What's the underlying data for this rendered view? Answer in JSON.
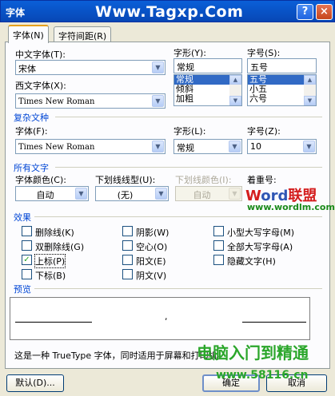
{
  "window": {
    "title": "字体",
    "watermark": "Www.Tagxp.Com",
    "help_glyph": "?",
    "close_glyph": "×"
  },
  "tabs": [
    {
      "label": "字体(N)",
      "active": true
    },
    {
      "label": "字符间距(R)",
      "active": false
    }
  ],
  "font_tab": {
    "chinese_font": {
      "label": "中文字体(T):",
      "value": "宋体"
    },
    "western_font": {
      "label": "西文字体(X):",
      "value": "Times New Roman"
    },
    "style": {
      "label": "字形(Y):",
      "value": "常规",
      "items": [
        "常规",
        "倾斜",
        "加粗"
      ],
      "selected": 0
    },
    "size": {
      "label": "字号(S):",
      "value": "五号",
      "items": [
        "五号",
        "小五",
        "六号"
      ],
      "selected": 0
    },
    "complex": {
      "section": "复杂文种",
      "font_label": "字体(F):",
      "font_value": "Times New Roman",
      "style_label": "字形(L):",
      "style_value": "常规",
      "size_label": "字号(Z):",
      "size_value": "10"
    },
    "all_text": {
      "section": "所有文字",
      "color_label": "字体颜色(C):",
      "color_value": "自动",
      "underline_label": "下划线线型(U):",
      "underline_value": "(无)",
      "underline_color_label": "下划线颜色(I):",
      "underline_color_value": "自动",
      "emphasis_label": "着重号:"
    },
    "effects": {
      "section": "效果",
      "items": [
        {
          "label": "删除线(K)",
          "checked": false
        },
        {
          "label": "双删除线(G)",
          "checked": false
        },
        {
          "label": "上标(P)",
          "checked": true
        },
        {
          "label": "下标(B)",
          "checked": false
        },
        {
          "label": "阴影(W)",
          "checked": false
        },
        {
          "label": "空心(O)",
          "checked": false
        },
        {
          "label": "阳文(E)",
          "checked": false
        },
        {
          "label": "阴文(V)",
          "checked": false
        },
        {
          "label": "小型大写字母(M)",
          "checked": false
        },
        {
          "label": "全部大写字母(A)",
          "checked": false
        },
        {
          "label": "隐藏文字(H)",
          "checked": false
        }
      ]
    },
    "preview": {
      "section": "预览",
      "sample": ",",
      "description": "这是一种 TrueType 字体，同时适用于屏幕和打印机。"
    }
  },
  "buttons": {
    "default_label": "默认(D)...",
    "ok_label": "确定",
    "cancel_label": "取消"
  },
  "overlay": {
    "brand_w": "W",
    "brand_ord": "ord",
    "brand_cn": "联盟",
    "brand_url": "www.wordlm.com",
    "green_text": "电脑入门到精通",
    "green_url": "www.58116.cn"
  },
  "colors": {
    "titlebar": "#0a5fd8",
    "label_blue": "#0046d5",
    "selection": "#316ac5",
    "dialog_bg": "#ece9d8",
    "check_green": "#21a121"
  },
  "icons": {
    "dropdown": "chevron-down-icon",
    "scroll_up": "scroll-up-icon",
    "scroll_down": "scroll-down-icon",
    "check": "check-icon"
  }
}
